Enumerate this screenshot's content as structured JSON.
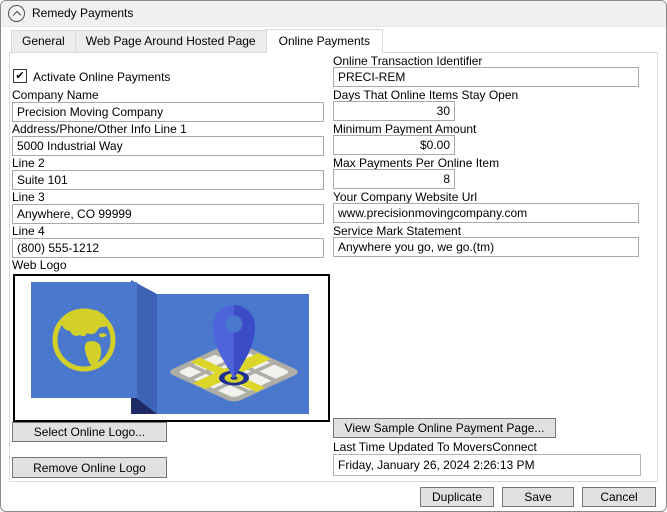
{
  "titlebar": {
    "title": "Remedy Payments",
    "collapse_icon": "chevron-up-circle"
  },
  "tabs": [
    {
      "label": "General",
      "active": false
    },
    {
      "label": "Web Page Around Hosted Page",
      "active": false
    },
    {
      "label": "Online Payments",
      "active": true
    }
  ],
  "form": {
    "activate": {
      "label": "Activate Online Payments",
      "checked": true,
      "check_glyph": "✔"
    },
    "company_name": {
      "label": "Company Name",
      "value": "Precision Moving Company"
    },
    "address1": {
      "label": "Address/Phone/Other Info Line 1",
      "value": "5000 Industrial Way"
    },
    "line2": {
      "label": "Line 2",
      "value": "Suite 101"
    },
    "line3": {
      "label": "Line 3",
      "value": "Anywhere, CO 99999"
    },
    "line4": {
      "label": "Line 4",
      "value": "(800) 555-1212"
    },
    "web_logo": {
      "label": "Web Logo"
    },
    "oti": {
      "label": "Online Transaction Identifier",
      "value": "PRECI-REM"
    },
    "days_open": {
      "label": "Days That Online Items Stay Open",
      "value": "30"
    },
    "min_payment": {
      "label": "Minimum Payment Amount",
      "value": "$0.00"
    },
    "max_payments": {
      "label": "Max Payments Per Online Item",
      "value": "8"
    },
    "website": {
      "label": "Your Company Website Url",
      "value": "www.precisionmovingcompany.com"
    },
    "service_mark": {
      "label": "Service Mark Statement",
      "value": "Anywhere you go, we go.(tm)"
    },
    "last_updated": {
      "label": "Last Time Updated To MoversConnect",
      "value": "Friday, January 26, 2024 2:26:13 PM"
    }
  },
  "buttons": {
    "select_logo": "Select Online Logo...",
    "remove_logo": "Remove Online Logo",
    "view_sample": "View Sample Online Payment Page...",
    "duplicate": "Duplicate",
    "save": "Save",
    "cancel": "Cancel"
  },
  "logo": {
    "description": "globe-and-map-pin company web logo",
    "colors": {
      "panel_blue": "#4a78cc",
      "fold_blue": "#3c63b5",
      "dark_navy": "#1d2a63",
      "globe_yellow": "#d4d02a",
      "map_gray": "#aeaea6",
      "street_white": "#f1f1ed",
      "road_yellow": "#ddd62a",
      "pin_blue_light": "#4e63da",
      "pin_blue_dark": "#3a4dc6",
      "target_navy": "#1e2f8f"
    }
  }
}
